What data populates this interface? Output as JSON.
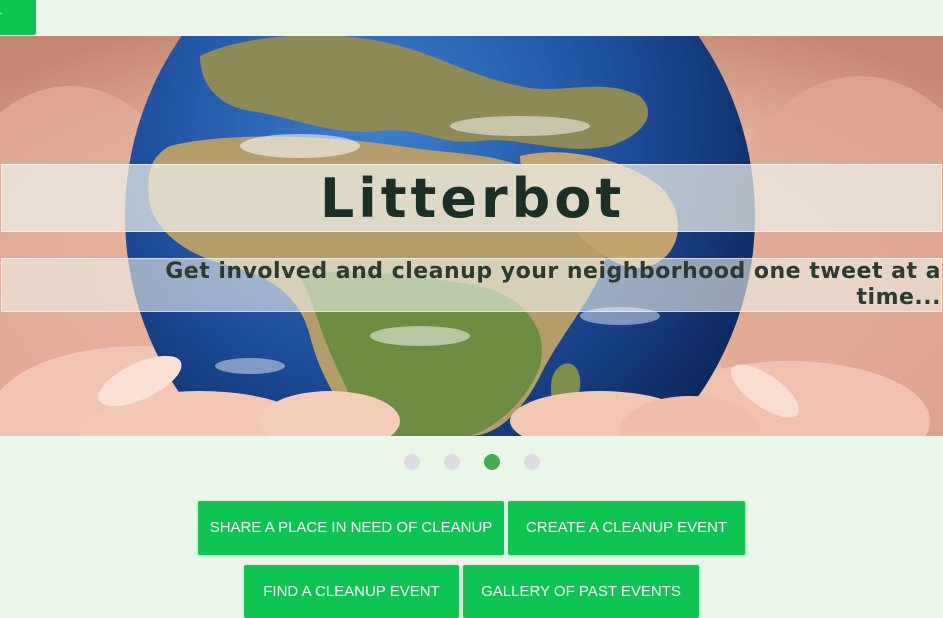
{
  "nav": {
    "tab_label": "T"
  },
  "hero": {
    "title": "Litterbot",
    "tagline": "Get involved and cleanup your neighborhood one tweet at a time..."
  },
  "carousel": {
    "slide_count": 4,
    "active_index": 2
  },
  "actions": {
    "share_label": "SHARE A PLACE IN NEED OF CLEANUP",
    "create_label": "CREATE A CLEANUP EVENT",
    "find_label": "FIND A CLEANUP EVENT",
    "gallery_label": "GALLERY OF PAST EVENTS"
  },
  "colors": {
    "background": "#e9f6e8",
    "button": "#0fc551",
    "dot_active": "#3fae4b",
    "dot_inactive": "#dedce0"
  }
}
